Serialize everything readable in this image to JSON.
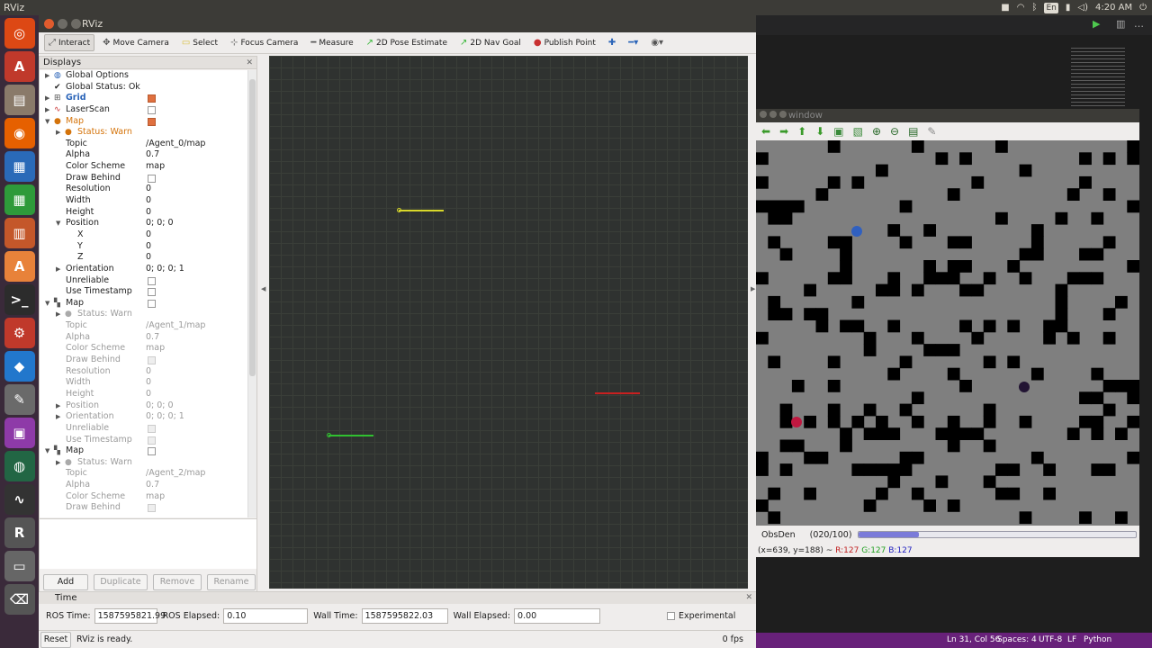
{
  "topbar": {
    "app": "RViz",
    "keyboard": "En",
    "time": "4:20 AM"
  },
  "launcher": {
    "items": [
      "ubuntu",
      "software",
      "files",
      "firefox",
      "writer",
      "calc",
      "impress",
      "appcenter",
      "terminal",
      "settings",
      "vscode",
      "text-editor",
      "workspaces",
      "globe",
      "monitor",
      "rviz",
      "drive",
      "trash"
    ]
  },
  "rviz": {
    "title": "RViz",
    "toolbar": {
      "interact": "Interact",
      "move_camera": "Move Camera",
      "select": "Select",
      "focus_camera": "Focus Camera",
      "measure": "Measure",
      "pose_estimate": "2D Pose Estimate",
      "nav_goal": "2D Nav Goal",
      "publish_point": "Publish Point"
    },
    "displays": {
      "title": "Displays",
      "global_options": "Global Options",
      "global_status": "Global Status: Ok",
      "grid": "Grid",
      "laserscan": "LaserScan",
      "map0": {
        "name": "Map",
        "status": "Status: Warn",
        "topic_label": "Topic",
        "topic": "/Agent_0/map",
        "alpha_label": "Alpha",
        "alpha": "0.7",
        "scheme_label": "Color Scheme",
        "scheme": "map",
        "draw_behind_label": "Draw Behind",
        "res_label": "Resolution",
        "res": "0",
        "width_label": "Width",
        "width": "0",
        "height_label": "Height",
        "height": "0",
        "pos_label": "Position",
        "pos": "0; 0; 0",
        "x_label": "X",
        "x": "0",
        "y_label": "Y",
        "y": "0",
        "z_label": "Z",
        "z": "0",
        "orient_label": "Orientation",
        "orient": "0; 0; 0; 1",
        "unreliable_label": "Unreliable",
        "timestamp_label": "Use Timestamp"
      },
      "map1": {
        "name": "Map",
        "status": "Status: Warn",
        "topic_label": "Topic",
        "topic": "/Agent_1/map",
        "alpha_label": "Alpha",
        "alpha": "0.7",
        "scheme_label": "Color Scheme",
        "scheme": "map",
        "draw_behind_label": "Draw Behind",
        "res_label": "Resolution",
        "res": "0",
        "width_label": "Width",
        "width": "0",
        "height_label": "Height",
        "height": "0",
        "pos_label": "Position",
        "pos": "0; 0; 0",
        "orient_label": "Orientation",
        "orient": "0; 0; 0; 1",
        "unreliable_label": "Unreliable",
        "timestamp_label": "Use Timestamp"
      },
      "map2": {
        "name": "Map",
        "status": "Status: Warn",
        "topic_label": "Topic",
        "topic": "/Agent_2/map",
        "alpha_label": "Alpha",
        "alpha": "0.7",
        "scheme_label": "Color Scheme",
        "scheme": "map",
        "draw_behind_label": "Draw Behind"
      },
      "buttons": {
        "add": "Add",
        "duplicate": "Duplicate",
        "remove": "Remove",
        "rename": "Rename"
      }
    },
    "time": {
      "title": "Time",
      "ros_time_label": "ROS Time:",
      "ros_time": "1587595821.99",
      "ros_elapsed_label": "ROS Elapsed:",
      "ros_elapsed": "0.10",
      "wall_time_label": "Wall Time:",
      "wall_time": "1587595822.03",
      "wall_elapsed_label": "Wall Elapsed:",
      "wall_elapsed": "0.00",
      "experimental": "Experimental"
    },
    "status": {
      "reset": "Reset",
      "message": "RViz is ready.",
      "fps": "0 fps"
    }
  },
  "cv": {
    "title": "window",
    "trackbar_label": "ObsDen",
    "trackbar_value": "(020/100)",
    "trackbar_fraction": 0.2,
    "status_pos": "(x=639, y=188) ~",
    "r": "R:127",
    "g": "G:127",
    "b": "B:127"
  },
  "ide": {
    "status": {
      "pos": "Ln 31, Col 56",
      "spaces": "Spaces: 4",
      "enc": "UTF-8",
      "eol": "LF",
      "lang": "Python"
    }
  },
  "colors": {
    "accent": "#e0703f",
    "grid_line": "#3a3e38",
    "agent_yellow": "#d8d82a",
    "agent_red": "#c82020",
    "agent_green": "#30c030"
  }
}
